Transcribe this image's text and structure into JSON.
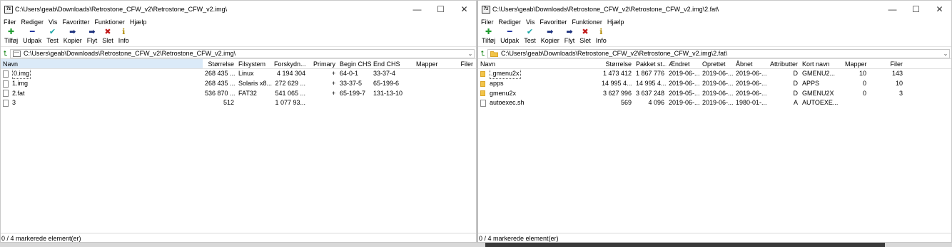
{
  "left": {
    "title": "C:\\Users\\geab\\Downloads\\Retrostone_CFW_v2\\Retrostone_CFW_v2.img\\",
    "app_icon_text": "7z",
    "window_controls": {
      "minimize": "—",
      "maximize": "☐",
      "close": "✕"
    },
    "menu": [
      "Filer",
      "Rediger",
      "Vis",
      "Favoritter",
      "Funktioner",
      "Hjælp"
    ],
    "toolbar": [
      {
        "label": "Tilføj",
        "glyph": "✚",
        "color": "#1e9b2e"
      },
      {
        "label": "Udpak",
        "glyph": "━",
        "color": "#1a2f9c"
      },
      {
        "label": "Test",
        "glyph": "✔",
        "color": "#16a4a4"
      },
      {
        "label": "Kopier",
        "glyph": "➡",
        "color": "#1a2f7c"
      },
      {
        "label": "Flyt",
        "glyph": "➡",
        "color": "#1a2f7c"
      },
      {
        "label": "Slet",
        "glyph": "✖",
        "color": "#c01818"
      },
      {
        "label": "Info",
        "glyph": "ℹ",
        "color": "#b08a00"
      }
    ],
    "address": "C:\\Users\\geab\\Downloads\\Retrostone_CFW_v2\\Retrostone_CFW_v2.img\\",
    "columns": [
      "Navn",
      "Størrelse",
      "Filsystem",
      "Forskydn...",
      "Primary",
      "Begin CHS",
      "End CHS",
      "Mapper",
      "Filer"
    ],
    "rows": [
      [
        "0.img",
        "268 435 ...",
        "Linux",
        "4 194 304",
        "+",
        "64-0-1",
        "33-37-4",
        "",
        ""
      ],
      [
        "1.img",
        "268 435 ...",
        "Solaris x8...",
        "272 629 ...",
        "+",
        "33-37-5",
        "65-199-6",
        "",
        ""
      ],
      [
        "2.fat",
        "536 870 ...",
        "FAT32",
        "541 065 ...",
        "+",
        "65-199-7",
        "131-13-10",
        "",
        ""
      ],
      [
        "3",
        "512",
        "",
        "1 077 93...",
        "",
        "",
        "",
        "",
        ""
      ]
    ],
    "status": "0 / 4 markerede element(er)"
  },
  "right": {
    "title": "C:\\Users\\geab\\Downloads\\Retrostone_CFW_v2\\Retrostone_CFW_v2.img\\2.fat\\",
    "app_icon_text": "7z",
    "window_controls": {
      "minimize": "—",
      "maximize": "☐",
      "close": "✕"
    },
    "menu": [
      "Filer",
      "Rediger",
      "Vis",
      "Favoritter",
      "Funktioner",
      "Hjælp"
    ],
    "toolbar": [
      {
        "label": "Tilføj",
        "glyph": "✚",
        "color": "#1e9b2e"
      },
      {
        "label": "Udpak",
        "glyph": "━",
        "color": "#1a2f9c"
      },
      {
        "label": "Test",
        "glyph": "✔",
        "color": "#16a4a4"
      },
      {
        "label": "Kopier",
        "glyph": "➡",
        "color": "#1a2f7c"
      },
      {
        "label": "Flyt",
        "glyph": "➡",
        "color": "#1a2f7c"
      },
      {
        "label": "Slet",
        "glyph": "✖",
        "color": "#c01818"
      },
      {
        "label": "Info",
        "glyph": "ℹ",
        "color": "#b08a00"
      }
    ],
    "address": "C:\\Users\\geab\\Downloads\\Retrostone_CFW_v2\\Retrostone_CFW_v2.img\\2.fat\\",
    "columns": [
      "Navn",
      "Størrelse",
      "Pakket st...",
      "Ændret",
      "Oprettet",
      "Åbnet",
      "Attributter",
      "Kort navn",
      "Mapper",
      "Filer"
    ],
    "rows": [
      [
        ".gmenu2x",
        "1 473 412",
        "1 867 776",
        "2019-06-...",
        "2019-06-...",
        "2019-06-...",
        "D",
        "GMENU2...",
        "10",
        "143"
      ],
      [
        "apps",
        "14 995 4...",
        "14 995 4...",
        "2019-06-...",
        "2019-06-...",
        "2019-06-...",
        "D",
        "APPS",
        "0",
        "10"
      ],
      [
        "gmenu2x",
        "3 627 996",
        "3 637 248",
        "2019-05-...",
        "2019-06-...",
        "2019-06-...",
        "D",
        "GMENU2X",
        "0",
        "3"
      ],
      [
        "autoexec.sh",
        "569",
        "4 096",
        "2019-06-...",
        "2019-06-...",
        "1980-01-...",
        "A",
        "AUTOEXE...",
        "",
        ""
      ]
    ],
    "status": "0 / 4 markerede element(er)"
  }
}
